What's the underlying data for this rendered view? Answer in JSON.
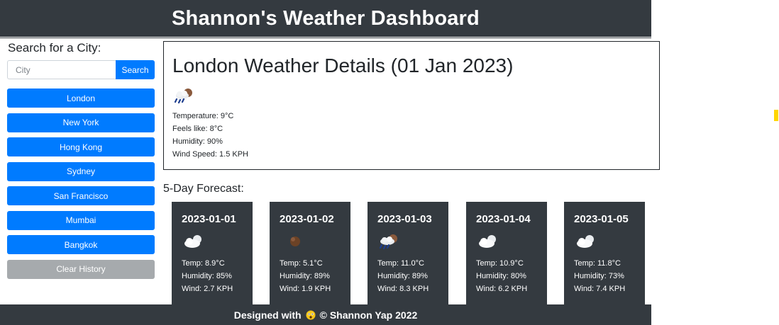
{
  "header": {
    "title": "Shannon's Weather Dashboard"
  },
  "sidebar": {
    "search_label": "Search for a City:",
    "search_placeholder": "City",
    "search_value": "",
    "search_button": "Search",
    "history": [
      {
        "label": "London"
      },
      {
        "label": "New York"
      },
      {
        "label": "Hong Kong"
      },
      {
        "label": "Sydney"
      },
      {
        "label": "San Francisco"
      },
      {
        "label": "Mumbai"
      },
      {
        "label": "Bangkok"
      }
    ],
    "clear_button": "Clear History"
  },
  "current": {
    "title": "London Weather Details (01 Jan 2023)",
    "icon": "rain-cloud-icon",
    "temperature": "Temperature: 9°C",
    "feels_like": "Feels like: 8°C",
    "humidity": "Humidity: 90%",
    "wind": "Wind Speed: 1.5 KPH"
  },
  "forecast": {
    "label": "5-Day Forecast:",
    "days": [
      {
        "date": "2023-01-01",
        "icon": "cloud-icon",
        "temp": "Temp: 8.9°C",
        "humidity": "Humidity: 85%",
        "wind": "Wind: 2.7 KPH"
      },
      {
        "date": "2023-01-02",
        "icon": "brown-cloud-icon",
        "temp": "Temp: 5.1°C",
        "humidity": "Humidity: 89%",
        "wind": "Wind: 1.9 KPH"
      },
      {
        "date": "2023-01-03",
        "icon": "rain-cloud-icon",
        "temp": "Temp: 11.0°C",
        "humidity": "Humidity: 89%",
        "wind": "Wind: 8.3 KPH"
      },
      {
        "date": "2023-01-04",
        "icon": "cloud-icon",
        "temp": "Temp: 10.9°C",
        "humidity": "Humidity: 80%",
        "wind": "Wind: 6.2 KPH"
      },
      {
        "date": "2023-01-05",
        "icon": "cloud-icon",
        "temp": "Temp: 11.8°C",
        "humidity": "Humidity: 73%",
        "wind": "Wind: 7.4 KPH"
      }
    ]
  },
  "footer": {
    "prefix": "Designed with",
    "icon": "shocked-face-icon",
    "suffix": "© Shannon Yap 2022"
  },
  "colors": {
    "dark": "#343a40",
    "primary": "#007bff",
    "secondary": "#a6aaad"
  }
}
